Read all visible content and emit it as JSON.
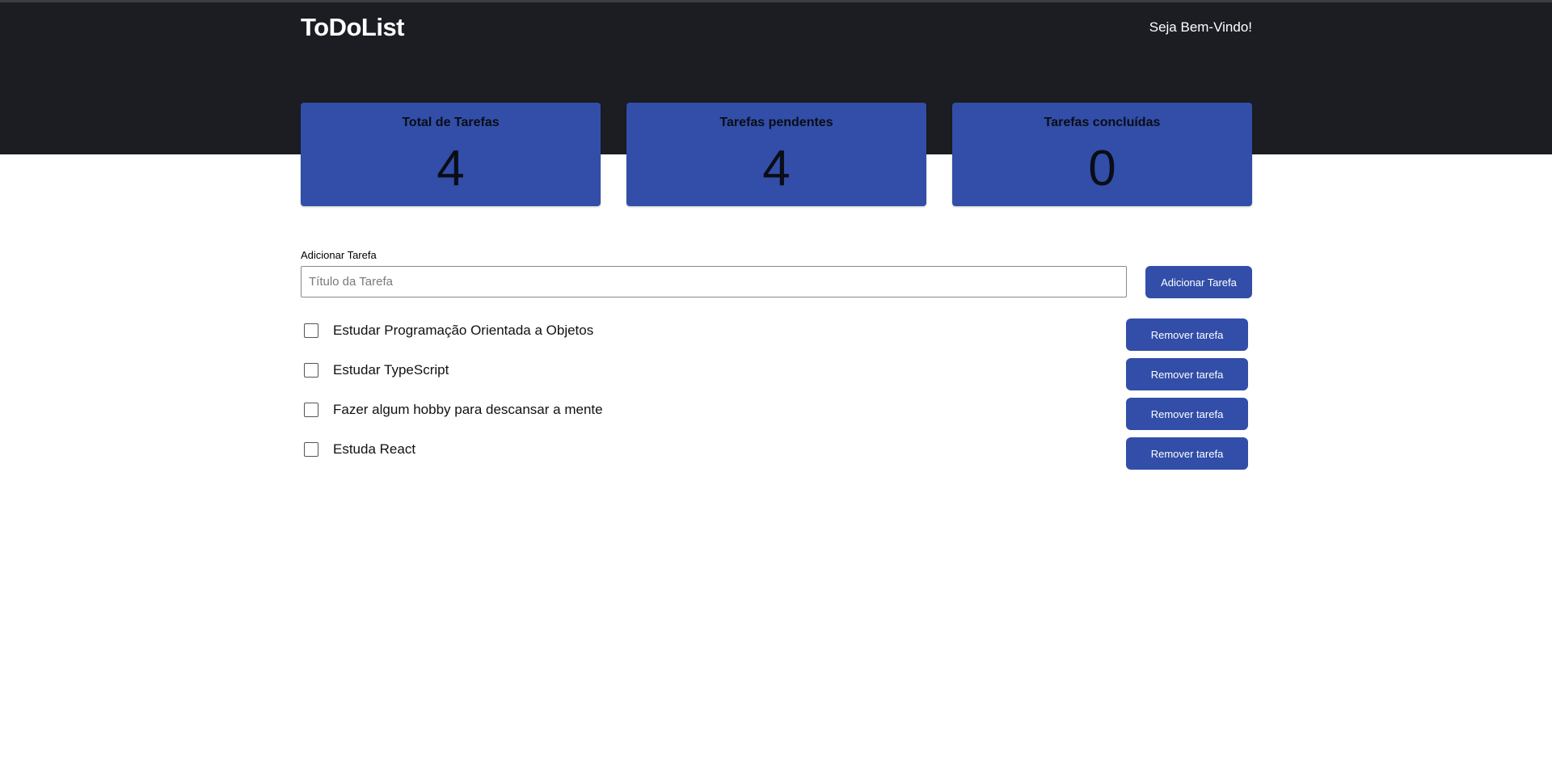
{
  "header": {
    "brand": "ToDoList",
    "welcome": "Seja Bem-Vindo!"
  },
  "stats": [
    {
      "label": "Total de Tarefas",
      "value": "4"
    },
    {
      "label": "Tarefas pendentes",
      "value": "4"
    },
    {
      "label": "Tarefas concluídas",
      "value": "0"
    }
  ],
  "add_task": {
    "label": "Adicionar Tarefa",
    "placeholder": "Título da Tarefa",
    "button_label": "Adicionar Tarefa"
  },
  "tasks": [
    {
      "title": "Estudar Programação Orientada a Objetos",
      "done": false,
      "remove_label": "Remover tarefa"
    },
    {
      "title": "Estudar TypeScript",
      "done": false,
      "remove_label": "Remover tarefa"
    },
    {
      "title": "Fazer algum hobby para descansar a mente",
      "done": false,
      "remove_label": "Remover tarefa"
    },
    {
      "title": "Estuda React",
      "done": false,
      "remove_label": "Remover tarefa"
    }
  ],
  "colors": {
    "header_bg": "#1b1d23",
    "accent": "#324ea8"
  }
}
